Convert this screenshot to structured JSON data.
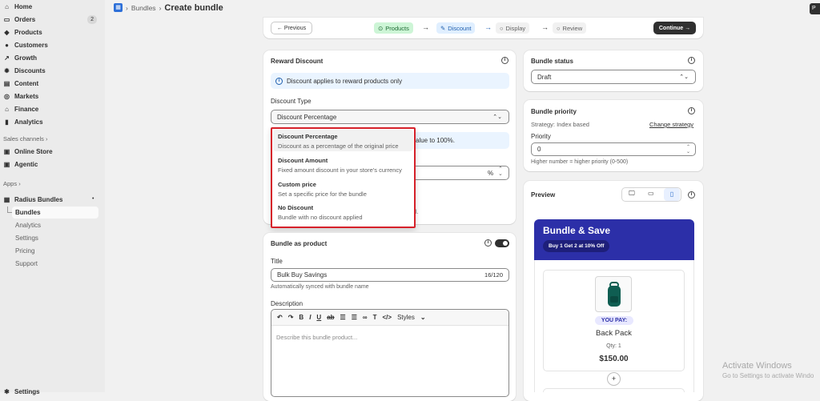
{
  "sidebar": {
    "items": [
      {
        "label": "Home",
        "icon": "home-icon"
      },
      {
        "label": "Orders",
        "icon": "inbox-icon",
        "badge": "2"
      },
      {
        "label": "Products",
        "icon": "tag-icon"
      },
      {
        "label": "Customers",
        "icon": "person-icon"
      },
      {
        "label": "Growth",
        "icon": "growth-icon"
      },
      {
        "label": "Discounts",
        "icon": "discount-icon"
      },
      {
        "label": "Content",
        "icon": "content-icon"
      },
      {
        "label": "Markets",
        "icon": "globe-icon"
      },
      {
        "label": "Finance",
        "icon": "bank-icon"
      },
      {
        "label": "Analytics",
        "icon": "bar-chart-icon"
      }
    ],
    "sales_channels_label": "Sales channels",
    "channels": [
      {
        "label": "Online Store",
        "icon": "store-icon"
      },
      {
        "label": "Agentic",
        "icon": "agentic-icon"
      }
    ],
    "apps_label": "Apps",
    "app": {
      "label": "Radius Bundles",
      "icon": "app-icon"
    },
    "app_items": [
      "Bundles",
      "Analytics",
      "Settings",
      "Pricing",
      "Support"
    ],
    "settings_label": "Settings"
  },
  "breadcrumb": {
    "parent": "Bundles",
    "sep": "›",
    "current": "Create bundle"
  },
  "stepper": {
    "previous": "← Previous",
    "steps": [
      "Products",
      "Discount",
      "Display",
      "Review"
    ],
    "continue": "Continue →",
    "arrow": "→"
  },
  "reward": {
    "title": "Reward Discount",
    "banner": "Discount applies to reward products only",
    "type_label": "Discount Type",
    "type_value": "Discount Percentage",
    "hint_partial": "alue to 100%.",
    "percent_sign": "%",
    "partial_text": "l."
  },
  "dropdown": [
    {
      "title": "Discount Percentage",
      "desc": "Discount as a percentage of the original price"
    },
    {
      "title": "Discount Amount",
      "desc": "Fixed amount discount in your store's currency"
    },
    {
      "title": "Custom price",
      "desc": "Set a specific price for the bundle"
    },
    {
      "title": "No Discount",
      "desc": "Bundle with no discount applied"
    }
  ],
  "bundle_product": {
    "title": "Bundle as product",
    "title_label": "Title",
    "title_value": "Bulk Buy Savings",
    "counter": "16/120",
    "synced": "Automatically synced with bundle name",
    "desc_label": "Description",
    "editor_styles": "Styles",
    "desc_placeholder": "Describe this bundle product..."
  },
  "status": {
    "title": "Bundle status",
    "value": "Draft"
  },
  "priority": {
    "title": "Bundle priority",
    "strategy": "Strategy: Index based",
    "change": "Change strategy",
    "label": "Priority",
    "value": "0",
    "help": "Higher number = higher priority (0-500)"
  },
  "preview": {
    "title": "Preview",
    "banner_title": "Bundle & Save",
    "pill": "Buy 1 Get 2 at 10% Off",
    "you_pay": "YOU PAY:",
    "product": "Back Pack",
    "qty": "Qty: 1",
    "price": "$150.00",
    "plus": "+"
  },
  "watermark": {
    "line1": "Activate Windows",
    "line2": "Go to Settings to activate Windo"
  },
  "colors": {
    "accent": "#2c2fa8",
    "step_active": "#d4f5dc",
    "step_current": "#e0efff",
    "highlight": "#d6212a"
  }
}
